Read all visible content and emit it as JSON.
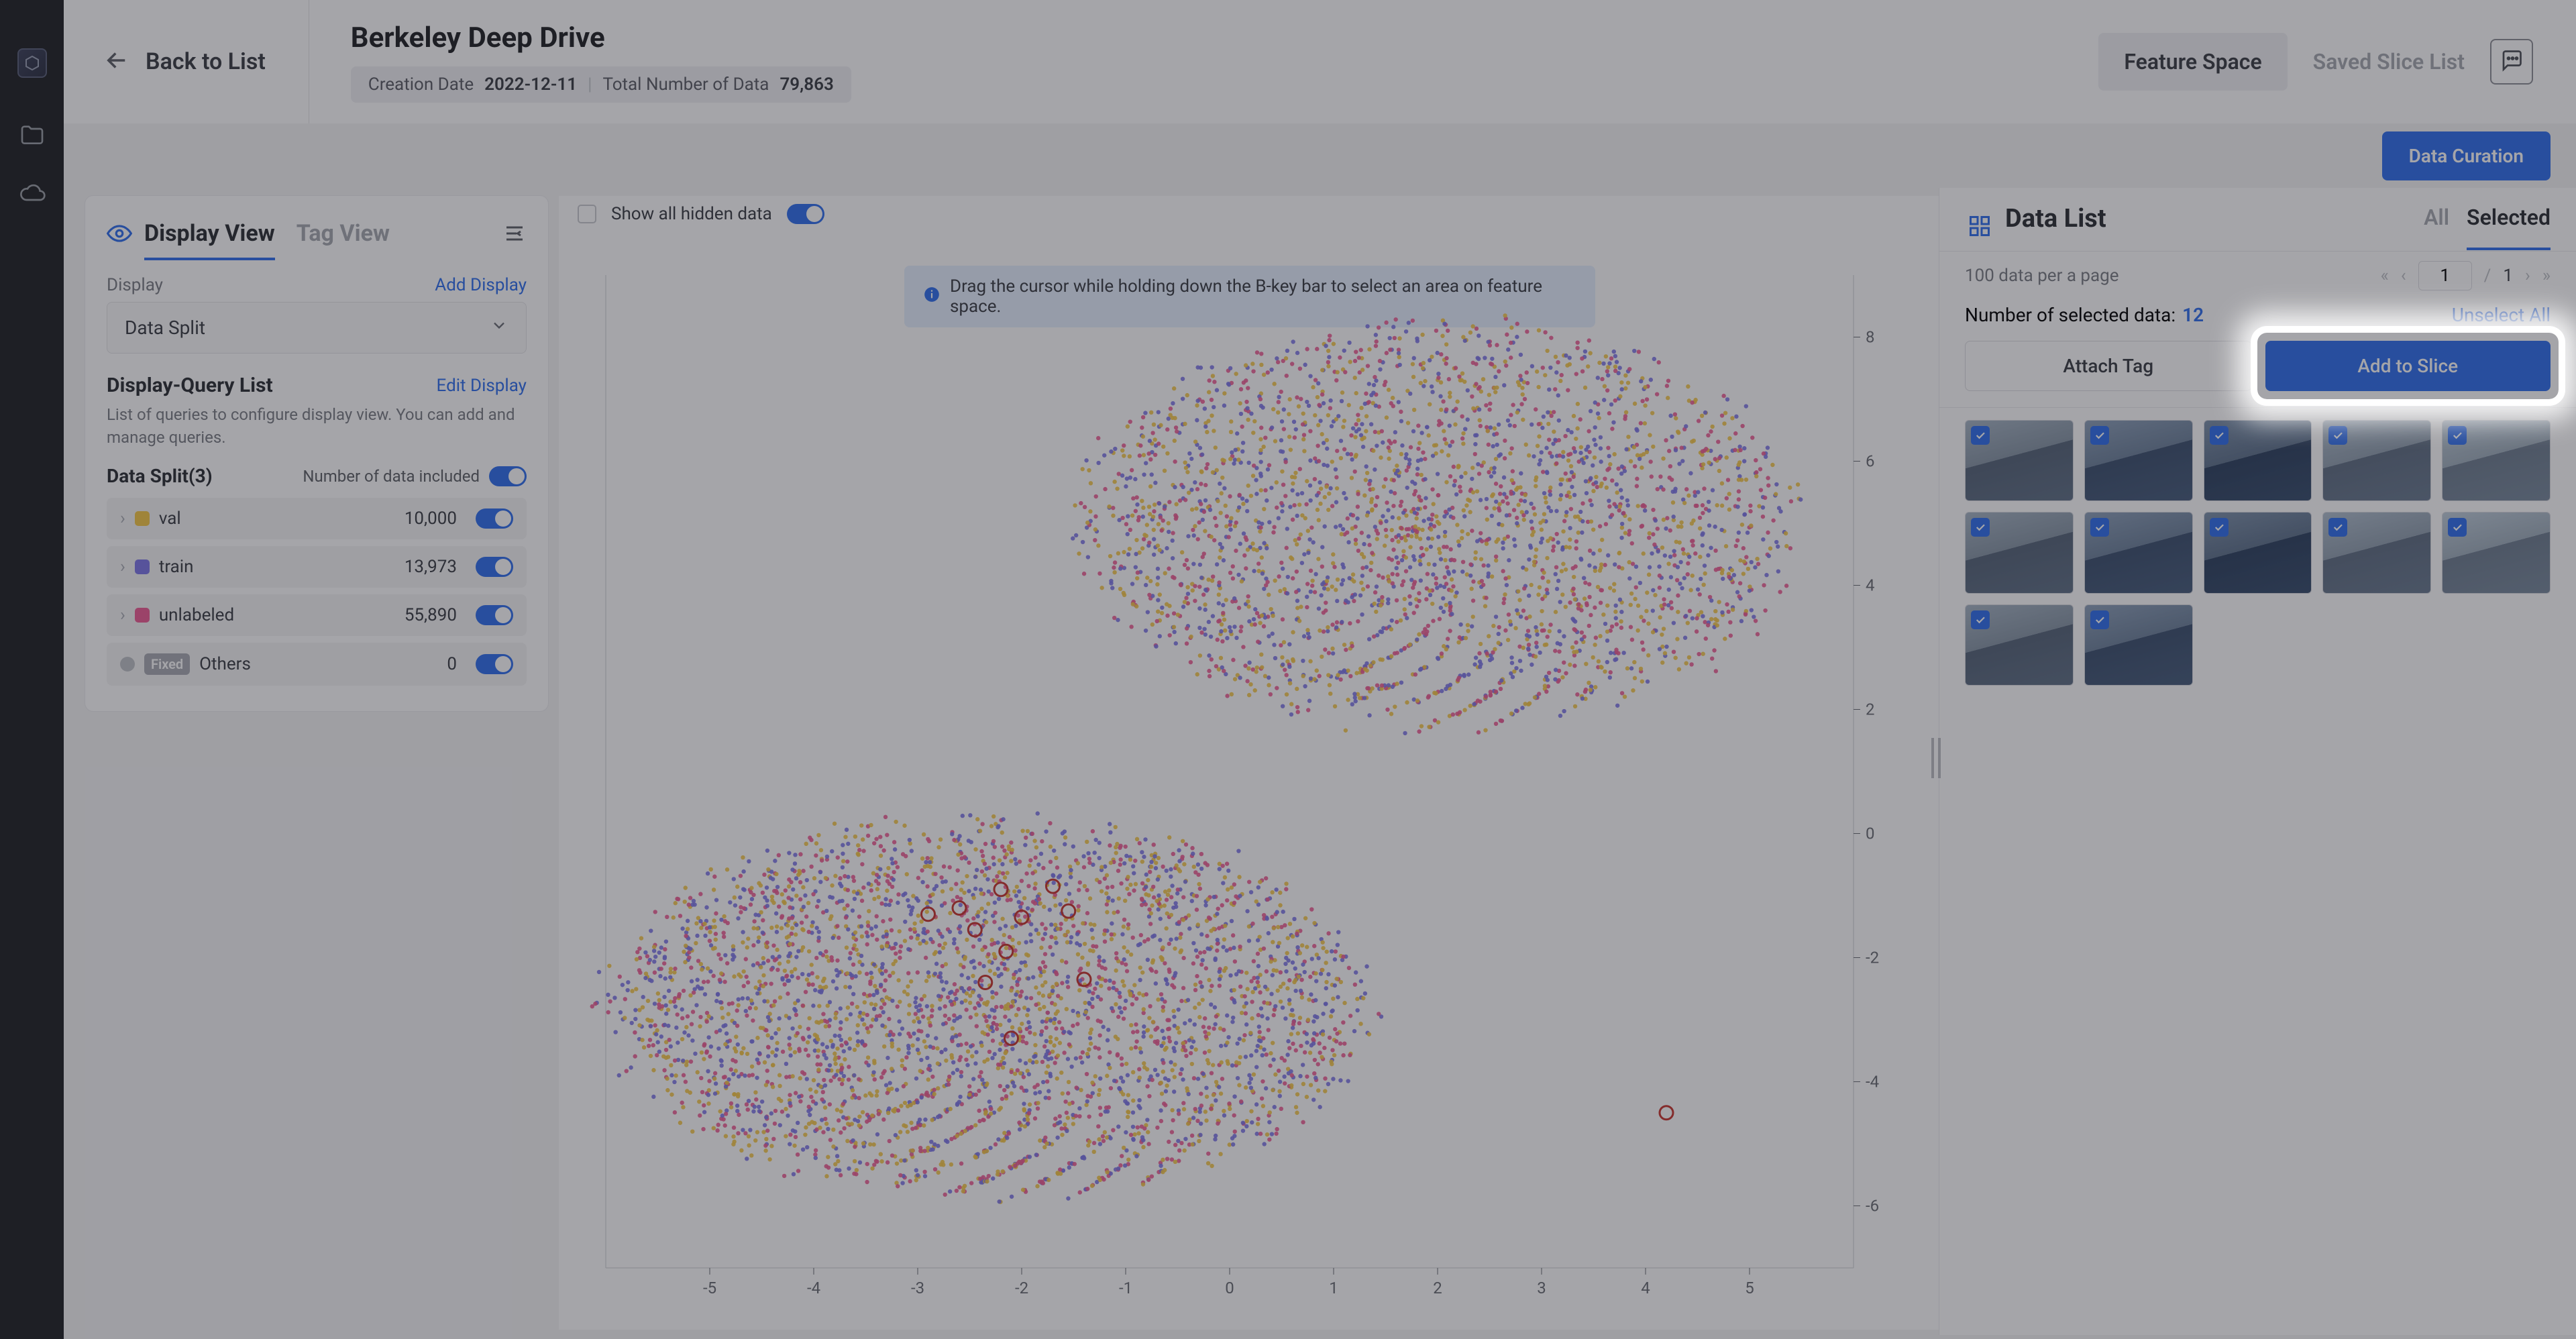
{
  "header": {
    "back_label": "Back to List",
    "title": "Berkeley Deep Drive",
    "creation_date_label": "Creation Date",
    "creation_date_value": "2022-12-11",
    "total_label": "Total Number of Data",
    "total_value": "79,863",
    "tab_feature_space": "Feature Space",
    "tab_saved_slice": "Saved Slice List"
  },
  "subbar": {
    "data_curation": "Data Curation"
  },
  "left_panel": {
    "tab_display": "Display View",
    "tab_tag": "Tag View",
    "display_label": "Display",
    "add_display": "Add Display",
    "dropdown_value": "Data Split",
    "dq_title": "Display-Query List",
    "edit_display": "Edit Display",
    "dq_sub": "List of queries to configure display view. You can add and manage queries.",
    "split_title": "Data Split(3)",
    "split_meta": "Number of data included",
    "splits": [
      {
        "name": "val",
        "count": "10,000",
        "cls": "val"
      },
      {
        "name": "train",
        "count": "13,973",
        "cls": "train"
      },
      {
        "name": "unlabeled",
        "count": "55,890",
        "cls": "unlabeled"
      }
    ],
    "fixed_label": "Fixed",
    "others_label": "Others",
    "others_count": "0"
  },
  "center": {
    "show_hidden": "Show all hidden data",
    "hint_full": "Drag the cursor while holding down the B-key bar to select an area on feature space."
  },
  "right_panel": {
    "title": "Data List",
    "tab_all": "All",
    "tab_selected": "Selected",
    "per_page": "100 data per a page",
    "page_total": "1",
    "sel_label": "Number of selected data:",
    "sel_count": "12",
    "unselect": "Unselect All",
    "attach_tag": "Attach Tag",
    "add_slice": "Add to Slice"
  },
  "chart_data": {
    "type": "scatter",
    "title": "",
    "xlabel": "",
    "ylabel": "",
    "xlim": [
      -6,
      6
    ],
    "ylim": [
      -7,
      9
    ],
    "x_ticks": [
      -5,
      -4,
      -3,
      -2,
      -1,
      0,
      1,
      2,
      3,
      4,
      5
    ],
    "y_ticks": [
      -6,
      -4,
      -2,
      0,
      2,
      4,
      6,
      8
    ],
    "legend": [
      "val",
      "train",
      "unlabeled"
    ],
    "colors": {
      "val": "#f6c847",
      "train": "#7d77e8",
      "unlabeled": "#ee5d94"
    },
    "clusters": [
      {
        "cx": 2.0,
        "cy": 5.0,
        "rx": 3.4,
        "ry": 3.2,
        "n": 2800
      },
      {
        "cx": -2.3,
        "cy": -2.8,
        "rx": 3.6,
        "ry": 3.0,
        "n": 3600
      }
    ],
    "selected_markers": [
      {
        "x": -2.2,
        "y": -0.9
      },
      {
        "x": -1.7,
        "y": -0.85
      },
      {
        "x": -2.6,
        "y": -1.2
      },
      {
        "x": -2.9,
        "y": -1.3
      },
      {
        "x": -2.45,
        "y": -1.55
      },
      {
        "x": -2.0,
        "y": -1.35
      },
      {
        "x": -1.55,
        "y": -1.25
      },
      {
        "x": -2.15,
        "y": -1.9
      },
      {
        "x": -2.35,
        "y": -2.4
      },
      {
        "x": -1.4,
        "y": -2.35
      },
      {
        "x": -2.1,
        "y": -3.3
      },
      {
        "x": 4.2,
        "y": -4.5
      }
    ]
  }
}
